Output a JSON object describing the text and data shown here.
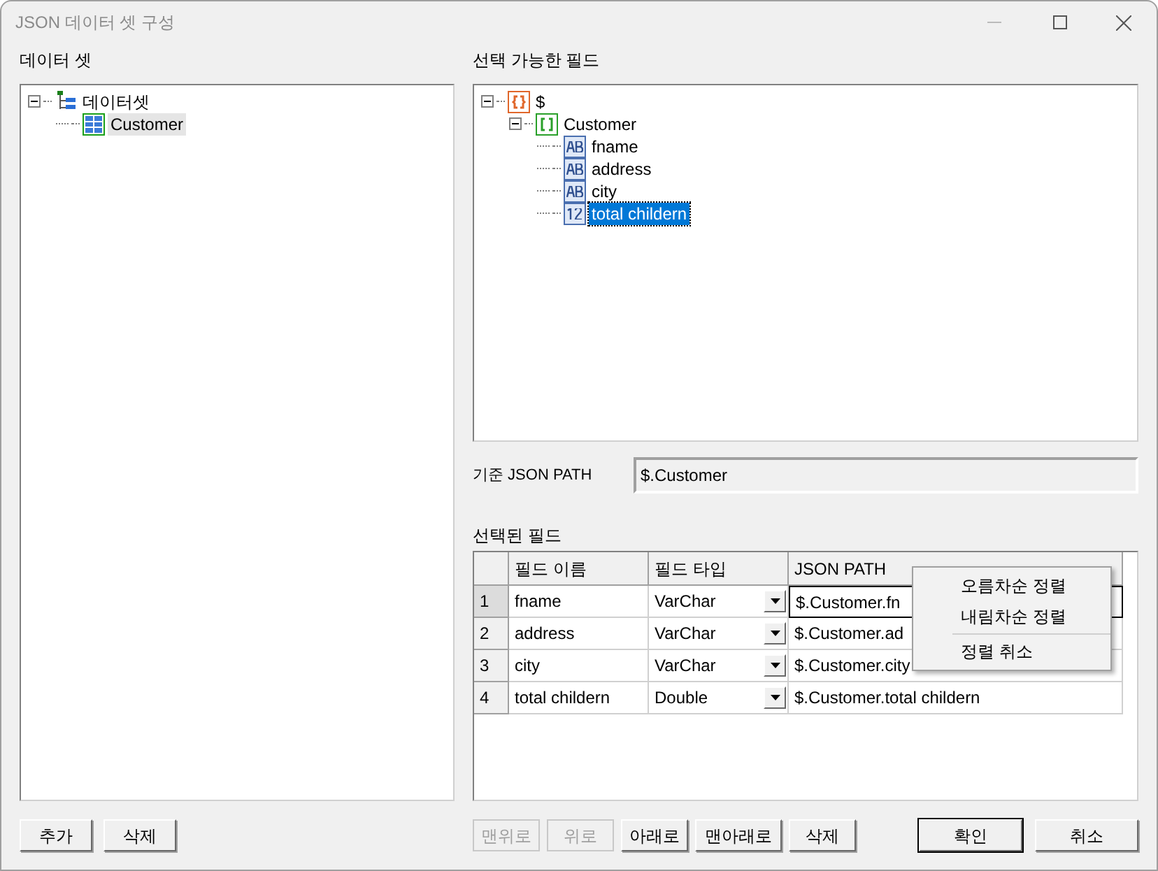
{
  "window": {
    "title": "JSON 데이터 셋 구성"
  },
  "dataset_panel": {
    "label": "데이터 셋",
    "tree": [
      {
        "label": "데이터셋",
        "kind": "root",
        "expanded": true,
        "selected": false,
        "children": [
          {
            "label": "Customer",
            "kind": "table",
            "selected": true
          }
        ]
      }
    ]
  },
  "fields_panel": {
    "label": "선택 가능한 필드",
    "tree": [
      {
        "label": "$",
        "kind": "object",
        "expanded": true,
        "selected": false,
        "children": [
          {
            "label": "Customer",
            "kind": "array",
            "expanded": true,
            "selected": false,
            "children": [
              {
                "label": "fname",
                "kind": "string",
                "selected": false
              },
              {
                "label": "address",
                "kind": "string",
                "selected": false
              },
              {
                "label": "city",
                "kind": "string",
                "selected": false
              },
              {
                "label": "total childern",
                "kind": "number",
                "selected": true
              }
            ]
          }
        ]
      }
    ]
  },
  "base_path": {
    "label": "기준 JSON PATH",
    "value": "$.Customer"
  },
  "selected_fields": {
    "label": "선택된 필드",
    "columns": [
      "필드 이름",
      "필드 타입",
      "JSON PATH"
    ],
    "rows": [
      {
        "index": "1",
        "name": "fname",
        "type": "VarChar",
        "path": "$.Customer.fn",
        "selected": true
      },
      {
        "index": "2",
        "name": "address",
        "type": "VarChar",
        "path": "$.Customer.ad",
        "selected": false
      },
      {
        "index": "3",
        "name": "city",
        "type": "VarChar",
        "path": "$.Customer.city",
        "selected": false
      },
      {
        "index": "4",
        "name": "total childern",
        "type": "Double",
        "path": "$.Customer.total childern",
        "selected": false
      }
    ]
  },
  "context_menu": {
    "items": [
      {
        "label": "오름차순 정렬",
        "separator_before": false
      },
      {
        "label": "내림차순 정렬",
        "separator_before": false
      },
      {
        "label": "정렬 취소",
        "separator_before": true
      }
    ]
  },
  "left_buttons": [
    {
      "label": "추가",
      "disabled": false
    },
    {
      "label": "삭제",
      "disabled": false
    }
  ],
  "order_buttons": [
    {
      "label": "맨위로",
      "disabled": true
    },
    {
      "label": "위로",
      "disabled": true
    },
    {
      "label": "아래로",
      "disabled": false
    },
    {
      "label": "맨아래로",
      "disabled": false
    },
    {
      "label": "삭제",
      "disabled": false
    }
  ],
  "dialog_buttons": [
    {
      "label": "확인",
      "default": true
    },
    {
      "label": "취소",
      "default": false
    }
  ]
}
